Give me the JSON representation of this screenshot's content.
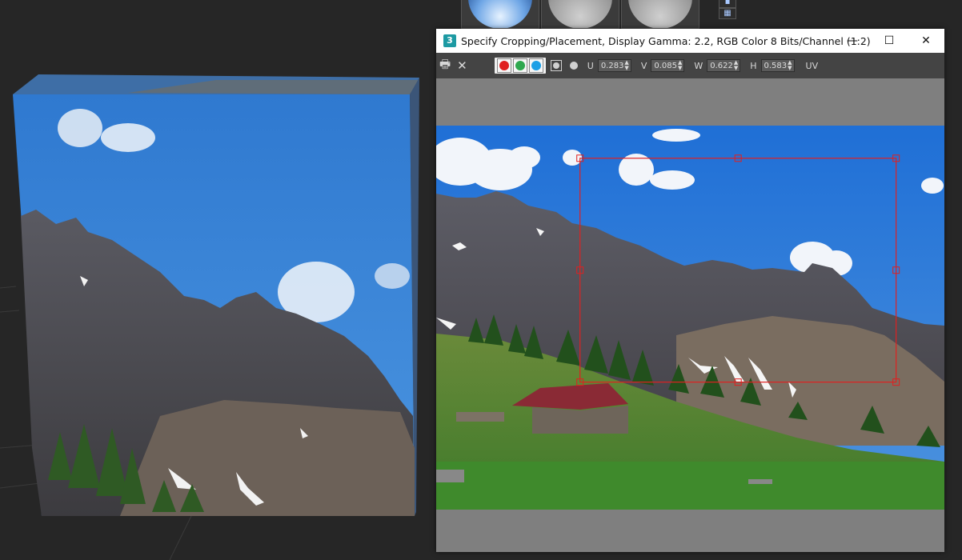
{
  "dialog": {
    "title": "Specify Cropping/Placement, Display Gamma: 2.2, RGB Color 8 Bits/Channel (1:2)",
    "app_icon": "3",
    "minimize_glyph": "—",
    "maximize_glyph": "☐",
    "close_glyph": "✕"
  },
  "toolbar": {
    "print_icon": "🖶",
    "close_icon": "✕",
    "channels": [
      {
        "name": "red",
        "color": "#e02020"
      },
      {
        "name": "green",
        "color": "#2fa84f"
      },
      {
        "name": "blue",
        "color": "#1ea0e6"
      }
    ],
    "u_label": "U",
    "u_value": "0.283",
    "v_label": "V",
    "v_value": "0.085",
    "w_label": "W",
    "w_value": "0.622",
    "h_label": "H",
    "h_value": "0.583",
    "uv_label": "UV"
  },
  "crop_region": {
    "u": 0.283,
    "v": 0.085,
    "w": 0.622,
    "h": 0.583,
    "color": "#e02020"
  },
  "colors": {
    "background": "#262626",
    "dialog_bg": "#7f7f7f",
    "toolbar_bg": "#444444",
    "crop_frame": "#e02020"
  }
}
